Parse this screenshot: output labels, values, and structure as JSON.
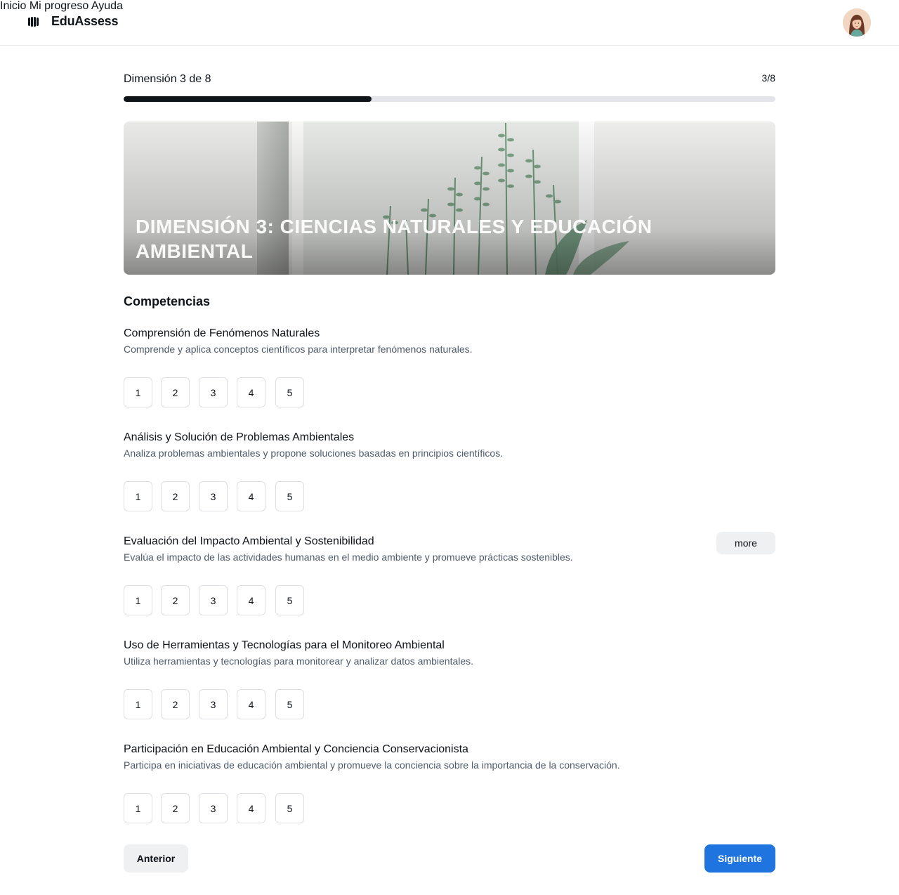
{
  "app": {
    "name": "EduAssess",
    "logo_icon": "brand-mark-icon"
  },
  "nav": {
    "items": [
      "Inicio",
      "Mi progreso",
      "Ayuda"
    ],
    "avatar_icon": "user-avatar"
  },
  "progress": {
    "label": "Dimensión 3 de 8",
    "count": "3/8",
    "current": 3,
    "total": 8,
    "fraction": 0.38
  },
  "hero": {
    "title": "Dimensión 3: Ciencias Naturales y Educación Ambiental"
  },
  "section": {
    "title": "Competencias"
  },
  "competencies": [
    {
      "title": "Comprensión de Fenómenos Naturales",
      "description": "Comprende y aplica conceptos científicos para interpretar fenómenos naturales.",
      "options": [
        "1",
        "2",
        "3",
        "4",
        "5"
      ]
    },
    {
      "title": "Análisis y Solución de Problemas Ambientales",
      "description": "Analiza problemas ambientales y propone soluciones basadas en principios científicos.",
      "options": [
        "1",
        "2",
        "3",
        "4",
        "5"
      ]
    },
    {
      "title": "Evaluación del Impacto Ambiental y Sostenibilidad",
      "description": "Evalúa el impacto de las actividades humanas en el medio ambiente y promueve prácticas sostenibles.",
      "options": [
        "1",
        "2",
        "3",
        "4",
        "5"
      ],
      "more_label": "more"
    },
    {
      "title": "Uso de Herramientas y Tecnologías para el Monitoreo Ambiental",
      "description": "Utiliza herramientas y tecnologías para monitorear y analizar datos ambientales.",
      "options": [
        "1",
        "2",
        "3",
        "4",
        "5"
      ]
    },
    {
      "title": "Participación en Educación Ambiental y Conciencia Conservacionista",
      "description": "Participa en iniciativas de educación ambiental y promueve la conciencia sobre la importancia de la conservación.",
      "options": [
        "1",
        "2",
        "3",
        "4",
        "5"
      ]
    }
  ],
  "footer": {
    "prev_label": "Anterior",
    "next_label": "Siguiente"
  },
  "colors": {
    "primary": "#1f74e0",
    "text": "#0f1419",
    "muted": "#4e5a68",
    "progress_track": "#e2e5e9"
  }
}
